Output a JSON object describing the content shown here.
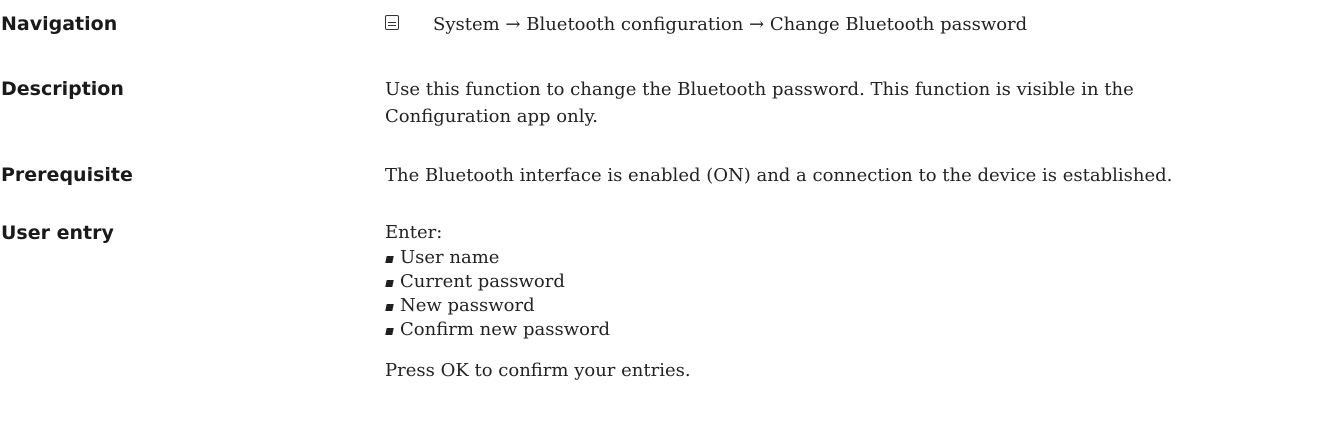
{
  "navigation": {
    "label": "Navigation",
    "icon": "menu-icon",
    "path": "System → Bluetooth configuration → Change Bluetooth password"
  },
  "description": {
    "label": "Description",
    "line1": "Use this function to change the Bluetooth password. This function is visible in the",
    "line2": "Configuration app only."
  },
  "prerequisite": {
    "label": "Prerequisite",
    "text": "The Bluetooth interface is enabled (ON) and a connection to the device is established."
  },
  "user_entry": {
    "label": "User entry",
    "intro": "Enter:",
    "items": [
      "User name",
      "Current password",
      "New password",
      "Confirm new password"
    ],
    "footer": "Press OK to confirm your entries."
  }
}
